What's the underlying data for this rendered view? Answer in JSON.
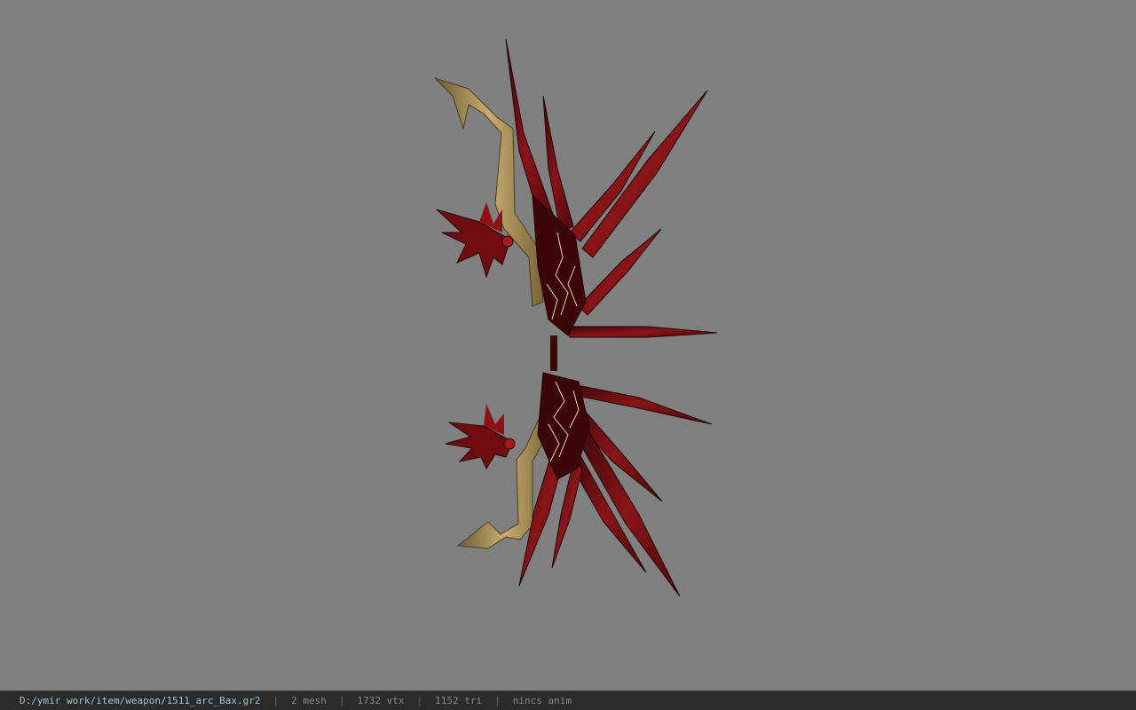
{
  "status_bar": {
    "file_path": "D:/ymir work/item/weapon/1511_arc_Bax.gr2",
    "mesh_count": "2 mesh",
    "vertex_count": "1732 vtx",
    "triangle_count": "1152 tri",
    "animation": "nincs anim",
    "separator": "|"
  },
  "viewport": {
    "background_color": "#808080",
    "model_name": "bow-model"
  }
}
